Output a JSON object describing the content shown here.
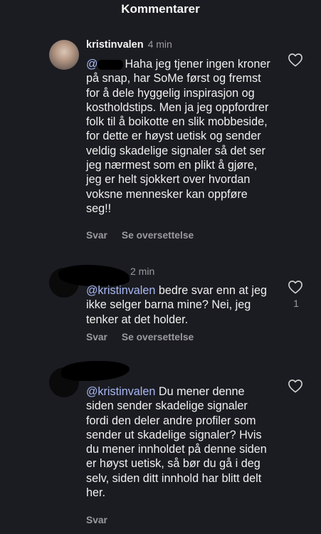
{
  "header": {
    "title": "Kommentarer"
  },
  "comments": [
    {
      "username": "kristinvalen",
      "time": "4 min",
      "mention": "@",
      "text": "Haha jeg tjener ingen kroner på snap, har SoMe først og fremst for å dele hyggelig inspirasjon og kostholdstips. Men ja jeg oppfordrer folk til å boikotte en slik mobbeside, for dette er høyst uetisk og sender veldig skadelige signaler så det ser jeg nærmest som en plikt å gjøre, jeg er helt sjokkert over hvordan voksne mennesker kan oppføre seg!!",
      "reply": "Svar",
      "translate": "Se oversettelse",
      "like_icon": "heart-outline-icon"
    },
    {
      "time": "2 min",
      "mention": "@kristinvalen",
      "text": " bedre svar enn at jeg ikke selger barna mine? Nei, jeg tenker at det holder.",
      "reply": "Svar",
      "translate": "Se oversettelse",
      "like_icon": "heart-outline-icon",
      "like_count": "1"
    },
    {
      "mention": "@kristinvalen",
      "text": " Du mener denne siden sender skadelige signaler fordi den deler andre profiler som sender ut skadelige signaler? Hvis du mener innholdet på denne siden er høyst uetisk, så bør du gå i deg selv, siden ditt innhold har blitt delt her.",
      "reply": "Svar",
      "like_icon": "heart-outline-icon"
    }
  ]
}
